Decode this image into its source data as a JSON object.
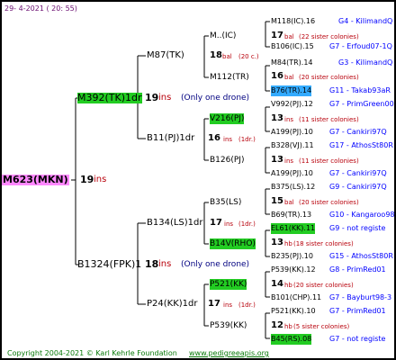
{
  "date": "29-  4-2021  ( 20: 55)",
  "copyright": "Copyright 2004-2021 © Karl Kehrle Foundation",
  "website": "www.pedigreeapis.org",
  "colors": {
    "root_bg": "#ff88ff",
    "highlight_green": "#22cc22",
    "highlight_blue": "#33aaff",
    "ins_red": "#b8000b",
    "links_blue": "#0000ff"
  },
  "root": {
    "name": "M623(MKN)",
    "ins": "19",
    "ins_label": "ins"
  },
  "g1": [
    {
      "name": "M392(TK)1dr",
      "ins": "19",
      "ins_label": "ins",
      "note": "(Only one drone)"
    },
    {
      "name": "B1324(FPK)1",
      "ins": "18",
      "ins_label": "ins",
      "note": "(Only one drone)"
    }
  ],
  "g2": [
    {
      "name": "M87(TK)"
    },
    {
      "name": "B11(PJ)1dr",
      "ins": "16",
      "ins_label": "ins",
      "note": "(1dr.)"
    },
    {
      "name": "B134(LS)1dr",
      "ins": "17",
      "ins_label": "ins",
      "note": "(1dr.)"
    },
    {
      "name": "P24(KK)1dr",
      "ins": "17",
      "ins_label": "ins",
      "note": "(1dr.)"
    }
  ],
  "g3": [
    {
      "name": "M..(IC)",
      "cnt": "18",
      "label": "bal",
      "sister": "(20 c.)"
    },
    {
      "name": "M112(TR)"
    },
    {
      "name": "V216(PJ)"
    },
    {
      "name": "B126(PJ)"
    },
    {
      "name": "B35(LS)"
    },
    {
      "name": "B14V(RHO)"
    },
    {
      "name": "P521(KK)"
    },
    {
      "name": "P539(KK)"
    }
  ],
  "g4": [
    {
      "name": "M118(IC).16",
      "link": "G4 - KilimandQ"
    },
    {
      "cnt": "17",
      "label": "bal",
      "rest": "(22 sister colonies)"
    },
    {
      "name": "B106(IC).15",
      "link": "G7 - Erfoud07-1Q"
    },
    {
      "name": "M84(TR).14",
      "link": "G3 - KilimandQ"
    },
    {
      "cnt": "16",
      "label": "bal",
      "rest": "(20 sister colonies)"
    },
    {
      "name": "B76(TR).14",
      "link": "G11 - Takab93aR"
    },
    {
      "name": "V992(PJ).12",
      "link": "G7 - PrimGreen00"
    },
    {
      "cnt": "13",
      "label": "ins",
      "rest": "(11 sister colonies)"
    },
    {
      "name": "A199(PJ).10",
      "link": "G7 - Cankiri97Q"
    },
    {
      "name": "B328(VJ).11",
      "link": "G17 - AthosSt80R"
    },
    {
      "cnt": "13",
      "label": "ins",
      "rest": "(11 sister colonies)"
    },
    {
      "name": "A199(PJ).10",
      "link": "G7 - Cankiri97Q"
    },
    {
      "name": "B375(LS).12",
      "link": "G9 - Cankiri97Q"
    },
    {
      "cnt": "15",
      "label": "bal",
      "rest": "(20 sister colonies)"
    },
    {
      "name": "B69(TR).13",
      "link": "G10 - Kangaroo98R"
    },
    {
      "name": "EL61(KK).11",
      "link": "G9 - not registe"
    },
    {
      "cnt": "13",
      "label": "hb",
      "rest": "(18 sister colonies)"
    },
    {
      "name": "B235(PJ).10",
      "link": "G15 - AthosSt80R"
    },
    {
      "name": "P539(KK).12",
      "link": "G8 - PrimRed01"
    },
    {
      "cnt": "14",
      "label": "hb",
      "rest": "(20 sister colonies)"
    },
    {
      "name": "B101(CHP).11",
      "link": "G7 - Bayburt98-3"
    },
    {
      "name": "P521(KK).10",
      "link": "G7 - PrimRed01"
    },
    {
      "cnt": "12",
      "label": "hb",
      "rest": "(5 sister colonies)"
    },
    {
      "name": "B45(RS).08",
      "link": "G7 - not registe"
    }
  ]
}
